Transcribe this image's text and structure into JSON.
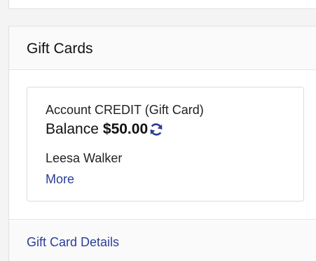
{
  "panel": {
    "title": "Gift Cards",
    "footer_link": "Gift Card Details"
  },
  "card": {
    "type_label": "Account CREDIT (Gift Card)",
    "balance_label": "Balance",
    "balance_amount": "$50.00",
    "holder_name": "Leesa Walker",
    "more_link": "More",
    "refresh_icon": "refresh-icon"
  },
  "colors": {
    "link": "#2c3e98",
    "icon": "#2c3e98"
  }
}
